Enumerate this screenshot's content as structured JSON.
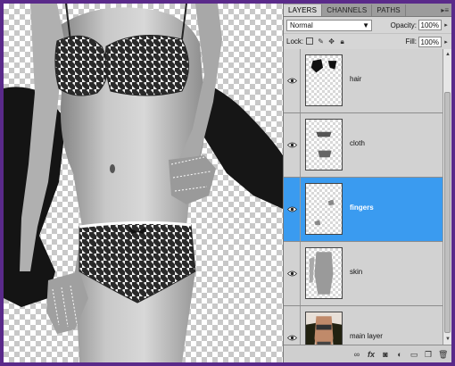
{
  "panel": {
    "tabs": [
      "LAYERS",
      "CHANNELS",
      "PATHS"
    ],
    "active_tab": "LAYERS",
    "tab_menu_icon": "panel-menu-icon",
    "blend_mode": "Normal",
    "opacity_label": "Opacity:",
    "opacity_value": "100%",
    "lock_label": "Lock:",
    "fill_label": "Fill:",
    "fill_value": "100%"
  },
  "layers": [
    {
      "name": "hair",
      "selected": false,
      "visible": true
    },
    {
      "name": "cloth",
      "selected": false,
      "visible": true
    },
    {
      "name": "fingers",
      "selected": true,
      "visible": true
    },
    {
      "name": "skin",
      "selected": false,
      "visible": true
    },
    {
      "name": "main layer",
      "selected": false,
      "visible": true
    }
  ],
  "bottom_icons": [
    "link-layers-icon",
    "fx-icon",
    "mask-icon",
    "adjustment-icon",
    "group-icon",
    "new-layer-icon",
    "trash-icon"
  ],
  "bottom_labels": {
    "fx": "fx"
  },
  "colors": {
    "selected_layer": "#3a9bf0",
    "frame": "#5b2b8c"
  }
}
